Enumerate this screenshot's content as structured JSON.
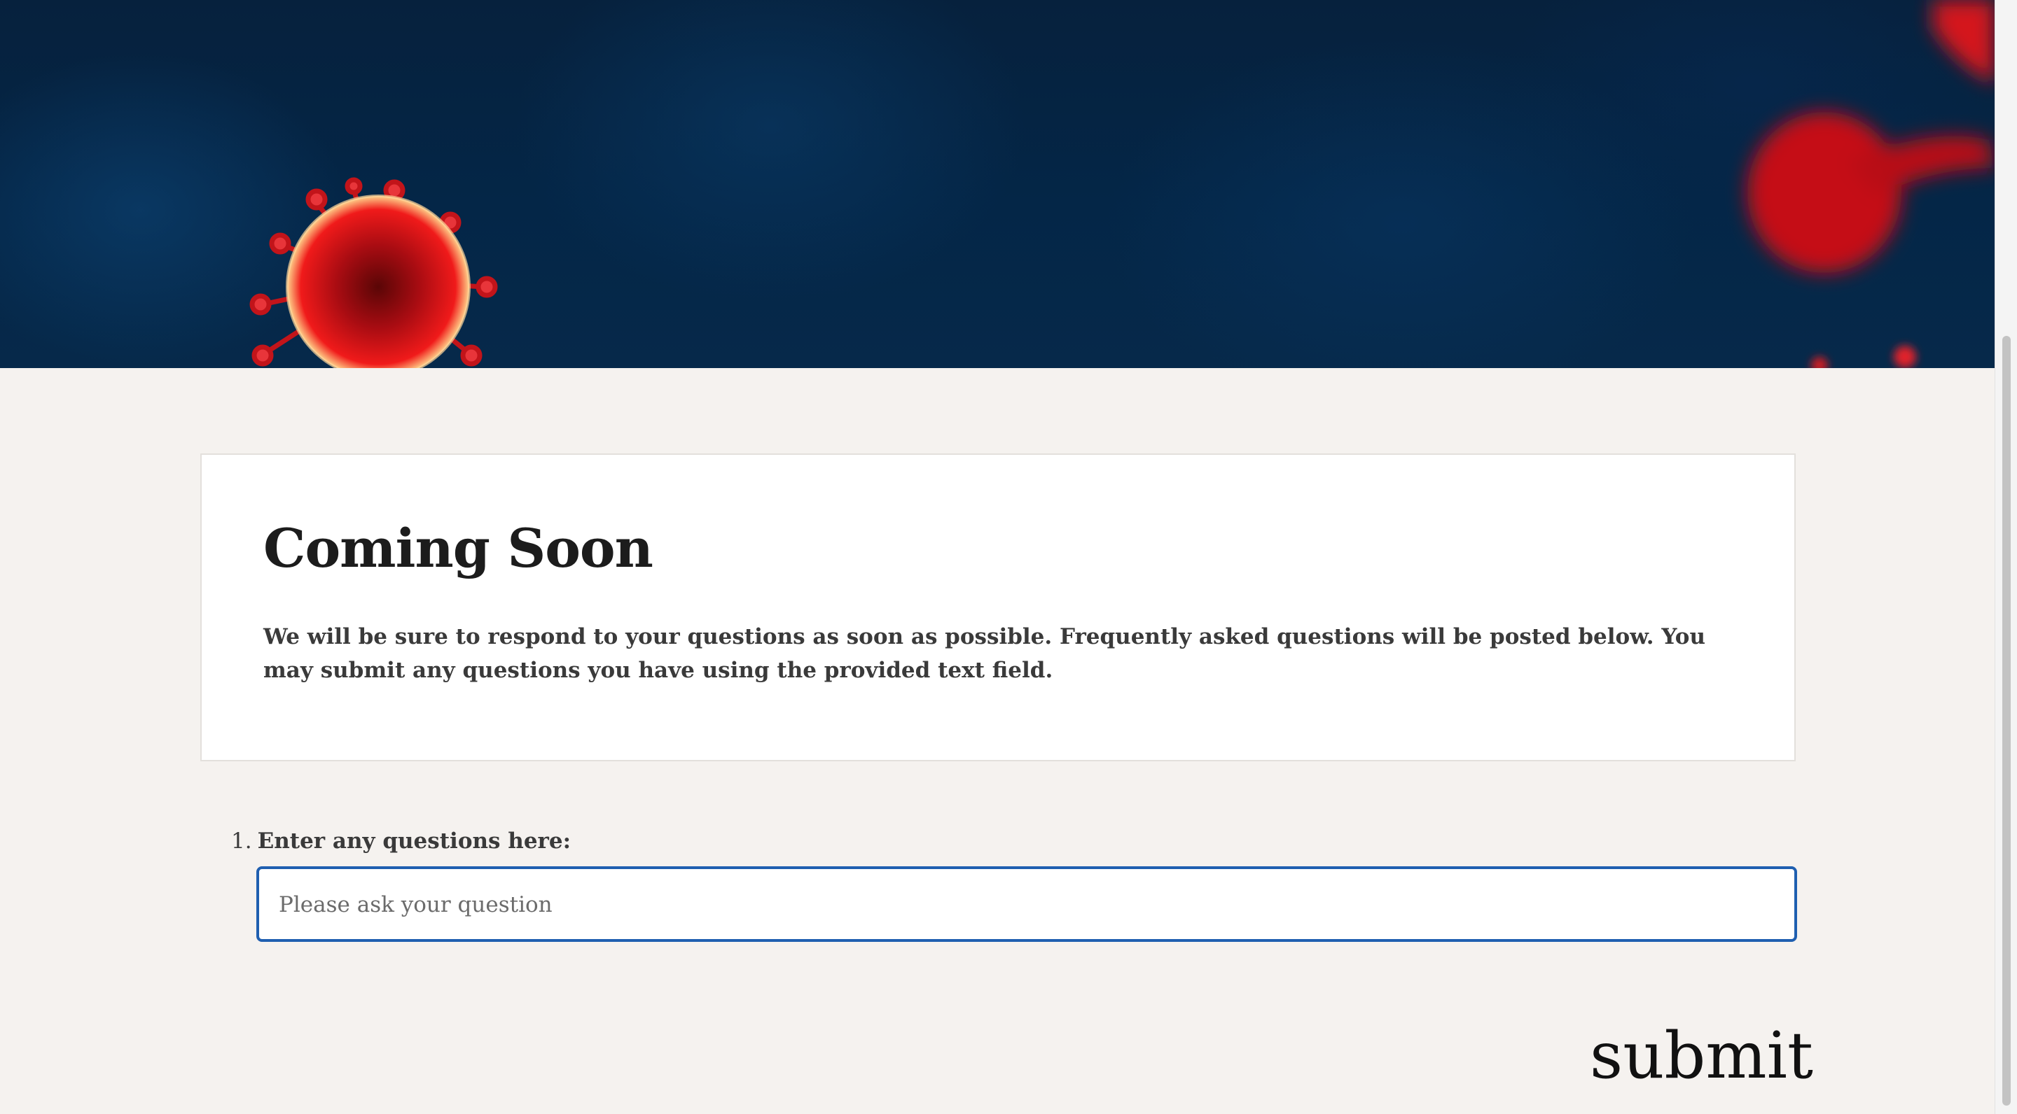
{
  "hero": {
    "image_name": "coronavirus-banner-image"
  },
  "card": {
    "title": "Coming Soon",
    "description": "We will be sure to respond to your questions as soon as possible. Frequently asked questions will be posted below. You may submit any questions you have using the provided text field."
  },
  "form": {
    "question_number": "1.",
    "question_label": "Enter any questions here:",
    "input_value": "",
    "input_placeholder": "Please ask your question",
    "submit_label": "submit"
  },
  "colors": {
    "hero_background": "#06213d",
    "virus_red": "#d5101a",
    "page_background": "#f5f2ef",
    "input_focus_border": "#1f5fb0"
  }
}
